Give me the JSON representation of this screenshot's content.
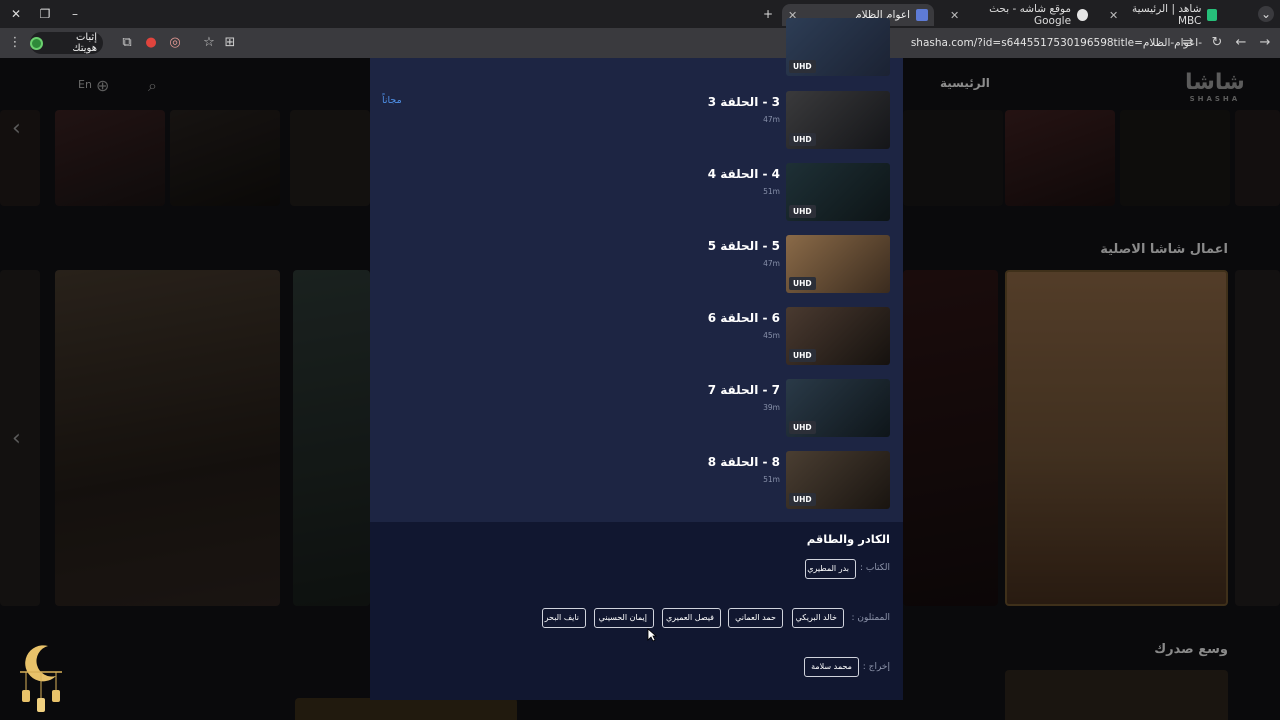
{
  "browser": {
    "tabs": [
      {
        "title": "شاهد | الرئيسية MBC",
        "active": false
      },
      {
        "title": "موقع شاشه - بحث Google",
        "active": false
      },
      {
        "title": "اعوام الظلام",
        "active": true
      }
    ],
    "new_tab": "+",
    "url": "shasha.com/?id=s6445517530196598title=اعوام-الظلام-",
    "verify_label": "إثبات هويتك"
  },
  "site": {
    "nav_home": "الرئيسية",
    "logo": "شاشا",
    "logo_sub": "SHASHA",
    "lang": "En",
    "section_originals": "اعمال شاشا الاصلية",
    "section_more": "وسع صدرك"
  },
  "modal": {
    "free_label": "مجاناً",
    "uhd_badge": "UHD",
    "episodes": [
      {
        "title": "3 - الحلقة 3",
        "duration": "47m"
      },
      {
        "title": "4 - الحلقة 4",
        "duration": "51m"
      },
      {
        "title": "5 - الحلقة 5",
        "duration": "47m"
      },
      {
        "title": "6 - الحلقة 6",
        "duration": "45m"
      },
      {
        "title": "7 - الحلقة 7",
        "duration": "39m"
      },
      {
        "title": "8 - الحلقة 8",
        "duration": "51m"
      }
    ],
    "crew": {
      "title": "الكادر والطاقم",
      "writers_label": "الكتاب :",
      "writers": [
        "بدر المطيري"
      ],
      "cast_label": "الممثلون :",
      "cast": [
        "خالد البريكي",
        "حمد العماني",
        "فيصل العميري",
        "إيمان الحسيني",
        "نايف البحر"
      ],
      "director_label": "إخراج :",
      "directors": [
        "محمد سلامة"
      ]
    }
  },
  "colors": {
    "modal_bg": "#1d2543",
    "crew_bg": "#111730",
    "link": "#4f90e6"
  }
}
